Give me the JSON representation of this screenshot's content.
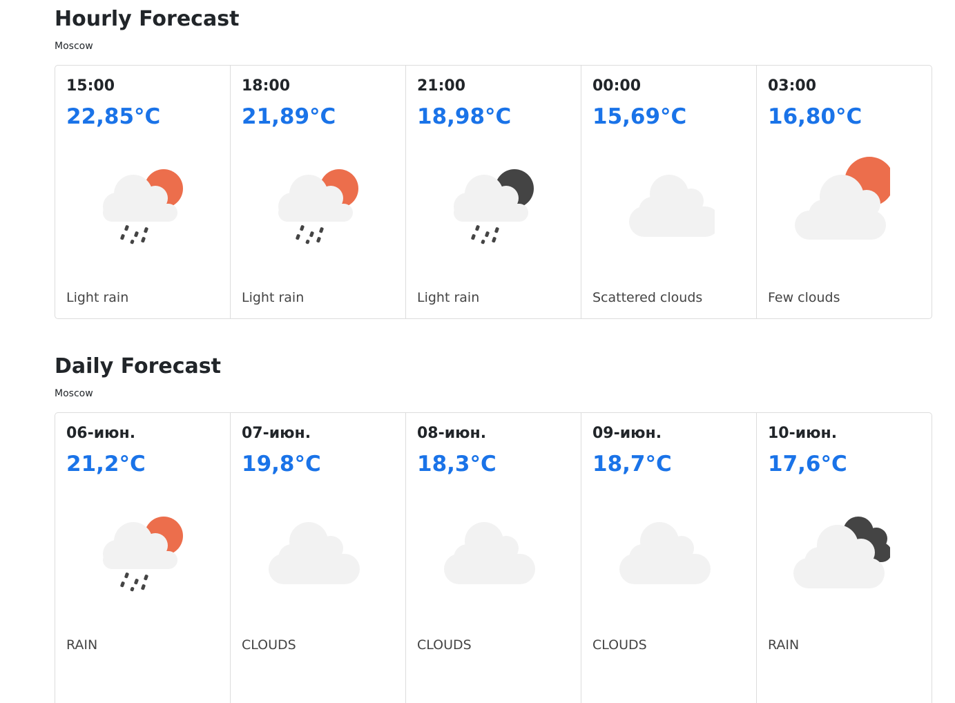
{
  "hourly": {
    "title": "Hourly Forecast",
    "city": "Moscow",
    "cards": [
      {
        "label": "15:00",
        "temp": "22,85°C",
        "desc": "Light rain",
        "icon": "rain-sun-icon"
      },
      {
        "label": "18:00",
        "temp": "21,89°C",
        "desc": "Light rain",
        "icon": "rain-sun-icon"
      },
      {
        "label": "21:00",
        "temp": "18,98°C",
        "desc": "Light rain",
        "icon": "rain-moon-icon"
      },
      {
        "label": "00:00",
        "temp": "15,69°C",
        "desc": "Scattered clouds",
        "icon": "cloud-icon"
      },
      {
        "label": "03:00",
        "temp": "16,80°C",
        "desc": "Few clouds",
        "icon": "cloud-sun-icon"
      }
    ]
  },
  "daily": {
    "title": "Daily Forecast",
    "city": "Moscow",
    "cards": [
      {
        "label": "06-июн.",
        "temp": "21,2°C",
        "desc": "RAIN",
        "icon": "rain-sun-icon"
      },
      {
        "label": "07-июн.",
        "temp": "19,8°C",
        "desc": "CLOUDS",
        "icon": "cloud-icon"
      },
      {
        "label": "08-июн.",
        "temp": "18,3°C",
        "desc": "CLOUDS",
        "icon": "cloud-icon"
      },
      {
        "label": "09-июн.",
        "temp": "18,7°C",
        "desc": "CLOUDS",
        "icon": "cloud-icon"
      },
      {
        "label": "10-июн.",
        "temp": "17,6°C",
        "desc": "RAIN",
        "icon": "heavy-clouds-icon"
      }
    ]
  },
  "colors": {
    "temperature": "#1a73e8",
    "sun": "#ec6e4c",
    "dark": "#444444",
    "cloud": "#f2f2f2"
  }
}
